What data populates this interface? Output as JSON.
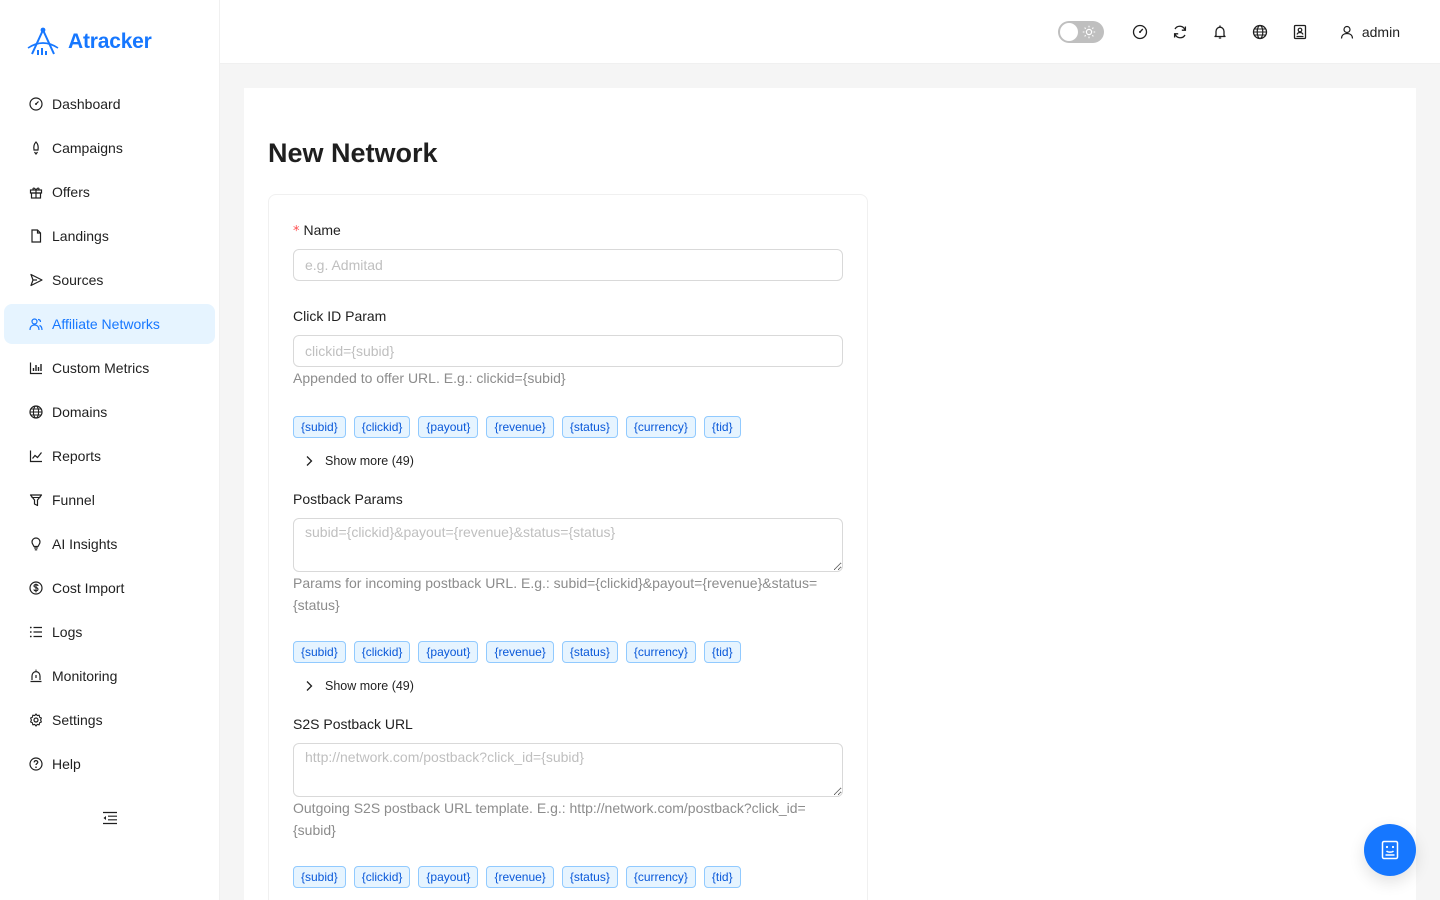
{
  "brand": {
    "name": "Atracker",
    "accent": "#1677ff"
  },
  "sidebar": {
    "items": [
      {
        "label": "Dashboard",
        "icon": "dashboard-icon"
      },
      {
        "label": "Campaigns",
        "icon": "rocket-icon"
      },
      {
        "label": "Offers",
        "icon": "gift-icon"
      },
      {
        "label": "Landings",
        "icon": "file-icon"
      },
      {
        "label": "Sources",
        "icon": "send-icon"
      },
      {
        "label": "Affiliate Networks",
        "icon": "team-icon",
        "active": true
      },
      {
        "label": "Custom Metrics",
        "icon": "bar-chart-icon"
      },
      {
        "label": "Domains",
        "icon": "globe-icon"
      },
      {
        "label": "Reports",
        "icon": "line-chart-icon"
      },
      {
        "label": "Funnel",
        "icon": "funnel-icon"
      },
      {
        "label": "AI Insights",
        "icon": "bulb-icon"
      },
      {
        "label": "Cost Import",
        "icon": "dollar-icon"
      },
      {
        "label": "Logs",
        "icon": "list-icon"
      },
      {
        "label": "Monitoring",
        "icon": "alert-icon"
      },
      {
        "label": "Settings",
        "icon": "gear-icon"
      },
      {
        "label": "Help",
        "icon": "question-icon"
      }
    ]
  },
  "header": {
    "theme_toggle_on": false,
    "user": "admin"
  },
  "page": {
    "title": "New Network"
  },
  "form": {
    "name": {
      "label": "Name",
      "required": true,
      "placeholder": "e.g. Admitad",
      "value": ""
    },
    "click_id": {
      "label": "Click ID Param",
      "placeholder": "clickid={subid}",
      "help": "Appended to offer URL. E.g.: clickid={subid}",
      "tags": [
        "{subid}",
        "{clickid}",
        "{payout}",
        "{revenue}",
        "{status}",
        "{currency}",
        "{tid}"
      ],
      "show_more": "Show more (49)"
    },
    "postback_params": {
      "label": "Postback Params",
      "placeholder": "subid={clickid}&payout={revenue}&status={status}",
      "help": "Params for incoming postback URL. E.g.: subid={clickid}&payout={revenue}&status={status}",
      "tags": [
        "{subid}",
        "{clickid}",
        "{payout}",
        "{revenue}",
        "{status}",
        "{currency}",
        "{tid}"
      ],
      "show_more": "Show more (49)"
    },
    "s2s_postback": {
      "label": "S2S Postback URL",
      "placeholder": "http://network.com/postback?click_id={subid}",
      "help": "Outgoing S2S postback URL template. E.g.: http://network.com/postback?click_id={subid}",
      "tags": [
        "{subid}",
        "{clickid}",
        "{payout}",
        "{revenue}",
        "{status}",
        "{currency}",
        "{tid}"
      ]
    }
  }
}
